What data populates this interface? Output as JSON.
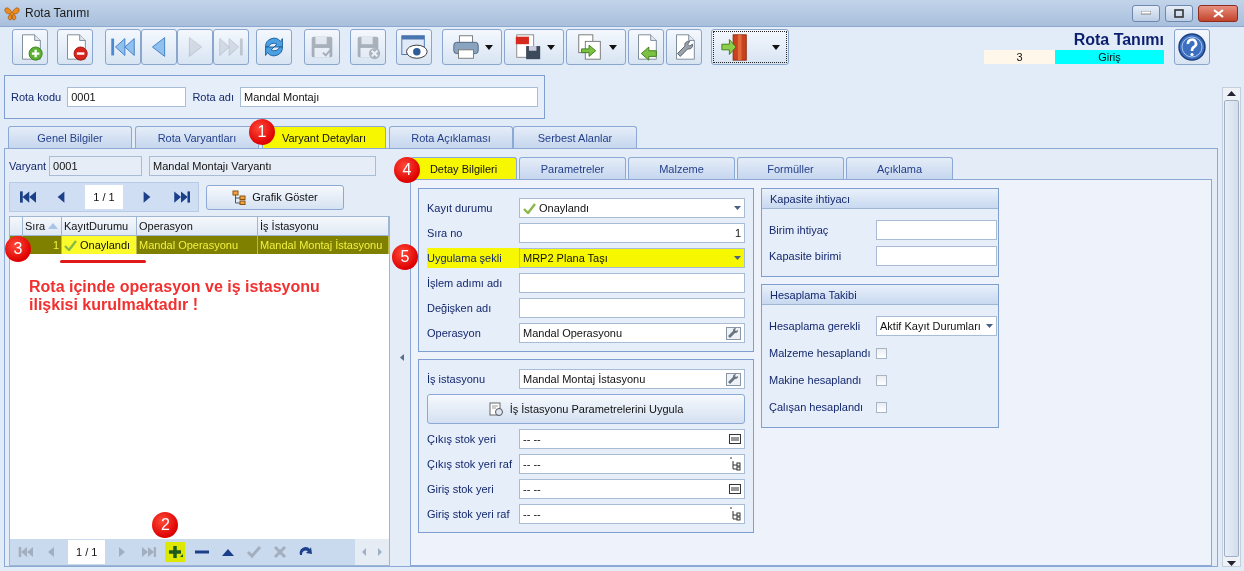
{
  "window": {
    "title": "Rota Tanımı"
  },
  "toolbar": [
    {
      "disabled": false,
      "dropdown": false,
      "focused": false
    },
    {
      "disabled": false,
      "dropdown": false,
      "focused": false
    },
    {
      "disabled": false,
      "dropdown": false,
      "focused": false
    },
    {
      "disabled": false,
      "dropdown": false,
      "focused": false
    },
    {
      "disabled": true,
      "dropdown": false,
      "focused": false
    },
    {
      "disabled": true,
      "dropdown": false,
      "focused": false
    },
    {
      "disabled": false,
      "dropdown": false,
      "focused": false
    },
    {
      "disabled": true,
      "dropdown": false,
      "focused": false
    },
    {
      "disabled": true,
      "dropdown": false,
      "focused": false
    },
    {
      "disabled": false,
      "dropdown": false,
      "focused": false
    },
    {
      "disabled": false,
      "dropdown": true,
      "focused": false
    },
    {
      "disabled": false,
      "dropdown": true,
      "focused": false
    },
    {
      "disabled": false,
      "dropdown": true,
      "focused": false
    },
    {
      "disabled": false,
      "dropdown": false,
      "focused": false
    },
    {
      "disabled": false,
      "dropdown": false,
      "focused": false
    },
    {
      "disabled": false,
      "dropdown": true,
      "focused": true
    }
  ],
  "header": {
    "title": "Rota Tanımı",
    "record_number": "3",
    "mode": "Giriş"
  },
  "route": {
    "fields": [
      {
        "label": "Rota kodu",
        "value": "0001"
      },
      {
        "label": "Rota adı",
        "value": "Mandal Montajı"
      }
    ]
  },
  "tabs": [
    {
      "label": "Genel Bilgiler",
      "selected": false
    },
    {
      "label": "Rota Varyantları",
      "selected": false
    },
    {
      "label": "Varyant Detayları",
      "selected": true,
      "callout": "1"
    },
    {
      "label": "Rota Açıklaması",
      "selected": false
    },
    {
      "label": "Serbest Alanlar",
      "selected": false
    }
  ],
  "variant": {
    "label": "Varyant",
    "code": "0001",
    "name": "Mandal Montajı Varyantı"
  },
  "navigator": {
    "position": "1 / 1",
    "buttons": [
      {
        "disabled": false
      },
      {
        "disabled": false
      },
      {
        "disabled": false
      },
      {
        "disabled": false
      }
    ]
  },
  "graph_button": "Grafik Göster",
  "grid": {
    "columns": [
      {
        "label": "Sıra",
        "sorted": true
      },
      {
        "label": "KayıtDurumu",
        "sorted": false
      },
      {
        "label": "Operasyon",
        "sorted": false
      },
      {
        "label": "İş İstasyonu",
        "sorted": false
      }
    ],
    "rows": [
      {
        "selected": true,
        "callout": "3",
        "cells": [
          {
            "text": "1",
            "focused": false
          },
          {
            "text": "Onaylandı",
            "focused": true,
            "underlined": true
          },
          {
            "text": "Mandal Operasyonu",
            "focused": false
          },
          {
            "text": "Mandal Montaj İstasyonu",
            "focused": false
          }
        ]
      }
    ]
  },
  "annotation": "Rota içinde operasyon ve iş istasyonu ilişkisi kurulmaktadır !",
  "bottom_navigator": {
    "position": "1 / 1",
    "buttons": [
      {
        "disabled": true,
        "highlighted": false
      },
      {
        "disabled": true,
        "highlighted": false
      },
      {
        "disabled": true,
        "highlighted": false
      },
      {
        "disabled": true,
        "highlighted": false
      },
      {
        "disabled": false,
        "highlighted": true,
        "callout": "2"
      },
      {
        "disabled": false,
        "highlighted": false
      },
      {
        "disabled": false,
        "highlighted": false
      },
      {
        "disabled": true,
        "highlighted": false
      },
      {
        "disabled": true,
        "highlighted": false
      },
      {
        "disabled": false,
        "highlighted": false
      }
    ]
  },
  "detail_tabs": [
    {
      "label": "Detay Bilgileri",
      "selected": true,
      "callout": "4"
    },
    {
      "label": "Parametreler",
      "selected": false
    },
    {
      "label": "Malzeme",
      "selected": false
    },
    {
      "label": "Formüller",
      "selected": false
    },
    {
      "label": "Açıklama",
      "selected": false
    }
  ],
  "detail_form": {
    "fields": [
      {
        "label": "Kayıt durumu",
        "value": "Onaylandı",
        "kind": "status",
        "highlighted": false
      },
      {
        "label": "Sıra no",
        "value": "1",
        "kind": "number",
        "highlighted": false
      },
      {
        "label": "Uygulama şekli",
        "value": "MRP2 Plana Taşı",
        "kind": "dropdown",
        "highlighted": true,
        "callout": "5"
      },
      {
        "label": "İşlem adımı adı",
        "kind": "text",
        "highlighted": false
      },
      {
        "label": "Değişken adı",
        "kind": "text",
        "highlighted": false
      },
      {
        "label": "Operasyon",
        "value": "Mandal Operasyonu",
        "kind": "lookup",
        "highlighted": false
      }
    ]
  },
  "station_form": {
    "station": {
      "label": "İş istasyonu",
      "value": "Mandal Montaj İstasyonu",
      "kind": "lookup"
    },
    "apply_button": "İş İstasyonu Parametrelerini Uygula",
    "fields": [
      {
        "label": "Çıkış stok yeri",
        "value": "-- --",
        "kind": "barcode"
      },
      {
        "label": "Çıkış stok yeri raf",
        "value": "-- --",
        "kind": "tree"
      },
      {
        "label": "Giriş stok yeri",
        "value": "-- --",
        "kind": "barcode"
      },
      {
        "label": "Giriş stok yeri raf",
        "value": "-- --",
        "kind": "tree"
      }
    ]
  },
  "capacity": {
    "title": "Kapasite ihtiyacı",
    "fields": [
      {
        "label": "Birim ihtiyaç"
      },
      {
        "label": "Kapasite birimi"
      }
    ]
  },
  "calculation": {
    "title": "Hesaplama Takibi",
    "dropdown": {
      "label": "Hesaplama gerekli",
      "value": "Aktif Kayıt Durumları"
    },
    "checks": [
      {
        "label": "Malzeme hesaplandı",
        "checked": false
      },
      {
        "label": "Makine hesaplandı",
        "checked": false
      },
      {
        "label": "Çalışan hesaplandı",
        "checked": false
      }
    ]
  }
}
